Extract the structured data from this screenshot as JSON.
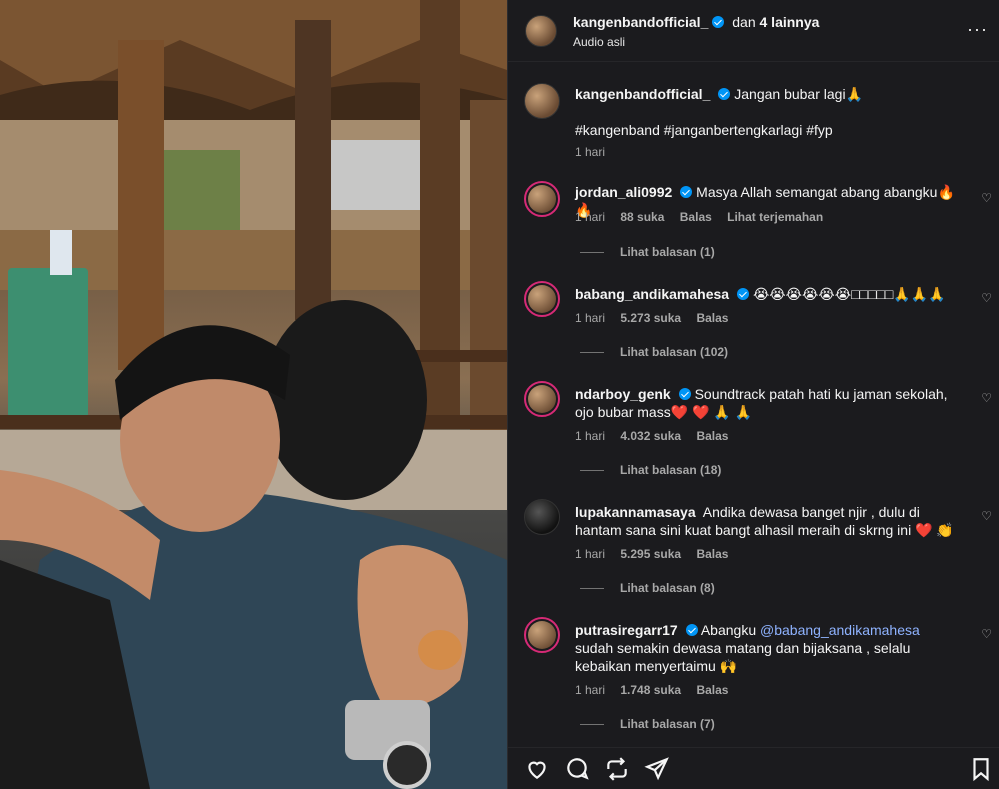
{
  "post": {
    "author": "kangenbandofficial_",
    "coauthors": "dan",
    "coauthors_more": "4 lainnya",
    "audio": "Audio asli",
    "caption": "Jangan bubar lagi🙏",
    "hashtags": "#kangenband #janganbertengkarlagi #fyp",
    "time": "1 hari"
  },
  "icons": {
    "more": "more-horizontal-icon",
    "like": "heart-icon",
    "comment": "comment-icon",
    "share": "repost-icon",
    "send": "send-icon",
    "save": "bookmark-icon"
  },
  "comments": [
    {
      "user": "jordan_ali0992",
      "text": "Masya Allah semangat abang abangku🔥🔥",
      "time": "1 hari",
      "likes": "88 suka",
      "reply": "Balas",
      "translate": "Lihat terjemahan",
      "replies": "Lihat balasan (1)"
    },
    {
      "user": "babang_andikamahesa",
      "text": "😭😭😭😭😭😭□□□□□🙏🙏🙏",
      "time": "1 hari",
      "likes": "5.273 suka",
      "reply": "Balas",
      "replies": "Lihat balasan (102)"
    },
    {
      "user": "ndarboy_genk",
      "text": "Soundtrack patah hati ku jaman sekolah, ojo bubar mass❤️ ❤️ 🙏 🙏",
      "time": "1 hari",
      "likes": "4.032 suka",
      "reply": "Balas",
      "replies": "Lihat balasan (18)"
    },
    {
      "user": "lupakannamasaya",
      "text": "Andika dewasa banget njir , dulu di hantam sana sini kuat bangt alhasil meraih di skrng ini ❤️ 👏",
      "time": "1 hari",
      "likes": "5.295 suka",
      "reply": "Balas",
      "replies": "Lihat balasan (8)"
    },
    {
      "user": "putrasiregarr17",
      "text_before": "Abangku",
      "mention": "@babang_andikamahesa",
      "text_after": "sudah semakin dewasa matang dan bijaksana , selalu kebaikan menyertaimu 🙌",
      "time": "1 hari",
      "likes": "1.748 suka",
      "reply": "Balas",
      "replies": "Lihat balasan (7)"
    }
  ],
  "colors": {
    "panel_bg": "#1b1b1e",
    "verified": "#0095f6",
    "link": "#8fb3ff",
    "muted": "#a8a8a8"
  }
}
